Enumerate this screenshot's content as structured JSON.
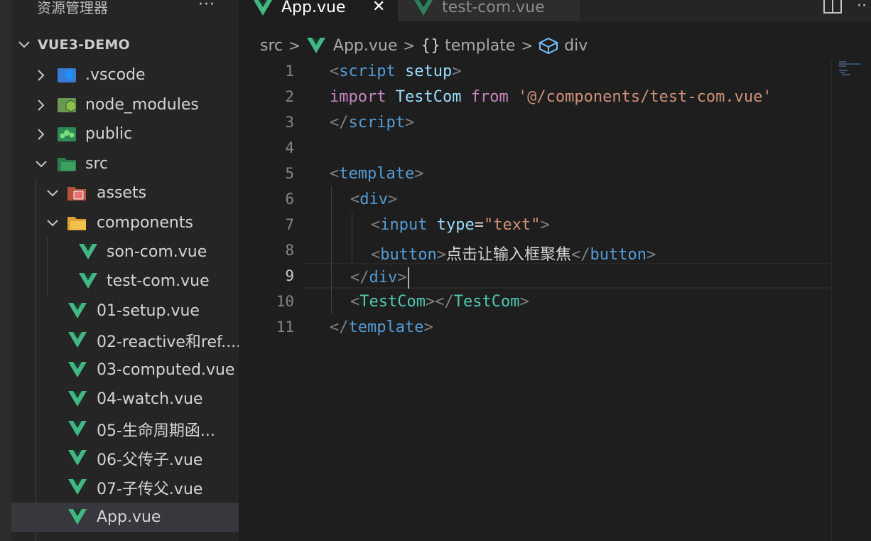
{
  "sidebar": {
    "header": "资源管理器",
    "more": "···",
    "root": "VUE3-DEMO",
    "items": [
      {
        "label": ".vscode"
      },
      {
        "label": "node_modules"
      },
      {
        "label": "public"
      },
      {
        "label": "src"
      },
      {
        "label": "assets"
      },
      {
        "label": "components"
      },
      {
        "label": "son-com.vue"
      },
      {
        "label": "test-com.vue"
      },
      {
        "label": "01-setup.vue"
      },
      {
        "label": "02-reactive和ref...."
      },
      {
        "label": "03-computed.vue"
      },
      {
        "label": "04-watch.vue"
      },
      {
        "label": "05-生命周期函..."
      },
      {
        "label": "06-父传子.vue"
      },
      {
        "label": "07-子传父.vue"
      },
      {
        "label": "App.vue"
      }
    ]
  },
  "tabs": [
    {
      "label": "App.vue",
      "close": "✕"
    },
    {
      "label": "test-com.vue"
    }
  ],
  "breadcrumb": {
    "folder": "src",
    "sep": ">",
    "file": "App.vue",
    "braces": "{}",
    "template": "template",
    "element": "div"
  },
  "editor": {
    "line_numbers": [
      "1",
      "2",
      "3",
      "4",
      "5",
      "6",
      "7",
      "8",
      "9",
      "10",
      "11"
    ],
    "current_line": "9",
    "l1": {
      "open": "<",
      "tag": "script",
      "attr": "setup",
      "close": ">"
    },
    "l2": {
      "kw1": "import",
      "cls": "TestCom",
      "kw2": "from",
      "str": "'@/components/test-com.vue'"
    },
    "l3": {
      "open": "</",
      "tag": "script",
      "close": ">"
    },
    "l5": {
      "open": "<",
      "tag": "template",
      "close": ">"
    },
    "l6": {
      "open": "<",
      "tag": "div",
      "close": ">"
    },
    "l7": {
      "open": "<",
      "tag": "input",
      "attr": "type",
      "eq": "=",
      "str": "\"text\"",
      "close": ">"
    },
    "l8": {
      "open": "<",
      "tag": "button",
      "close": ">",
      "text": "点击让输入框聚焦",
      "open2": "</",
      "tag2": "button",
      "close2": ">"
    },
    "l9": {
      "open": "</",
      "tag": "div",
      "close": ">"
    },
    "l10": {
      "open": "<",
      "tag": "TestCom",
      "mid": "></",
      "tag2": "TestCom",
      "close": ">"
    },
    "l11": {
      "open": "</",
      "tag": "template",
      "close": ">"
    }
  },
  "colors": {
    "accent": "#41b883",
    "tag": "#569cd6",
    "keyword": "#c586c0",
    "class": "#4ec9b0",
    "string": "#ce9178",
    "attribute": "#9cdcfe"
  }
}
